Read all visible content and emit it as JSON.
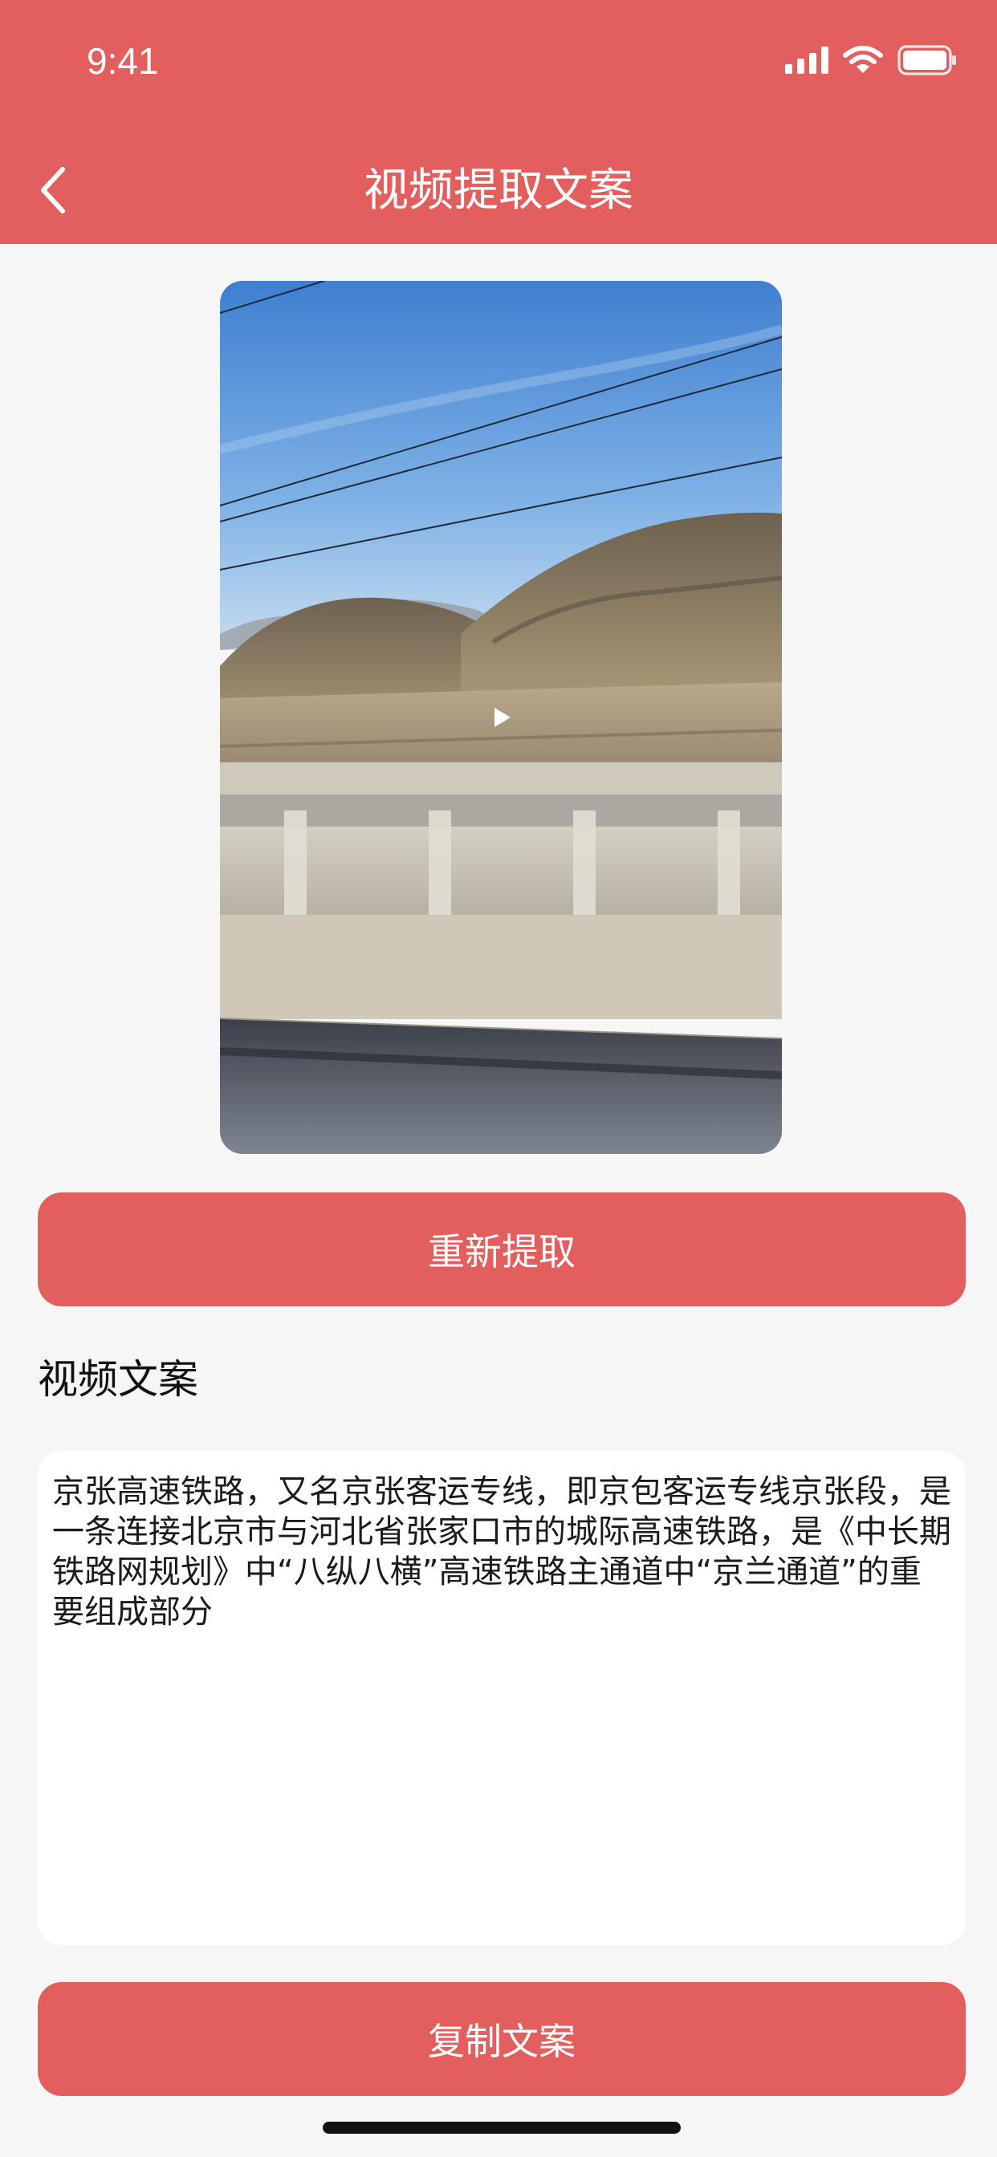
{
  "status_bar": {
    "time": "9:41",
    "icons": [
      "cellular-signal-icon",
      "wifi-icon",
      "battery-icon"
    ]
  },
  "nav": {
    "back_icon": "chevron-left-icon",
    "title": "视频提取文案"
  },
  "video": {
    "play_icon": "play-icon"
  },
  "actions": {
    "reextract_label": "重新提取",
    "copy_label": "复制文案"
  },
  "section": {
    "title": "视频文案"
  },
  "transcript": {
    "text": "京张高速铁路，又名京张客运专线，即京包客运专线京张段，是一条连接北京市与河北省张家口市的城际高速铁路，是《中长期铁路网规划》中“八纵八横”高速铁路主通道中“京兰通道”的重要组成部分"
  },
  "colors": {
    "accent": "#E35F5E",
    "background": "#F6F6F6",
    "panel": "#FFFFFF"
  }
}
